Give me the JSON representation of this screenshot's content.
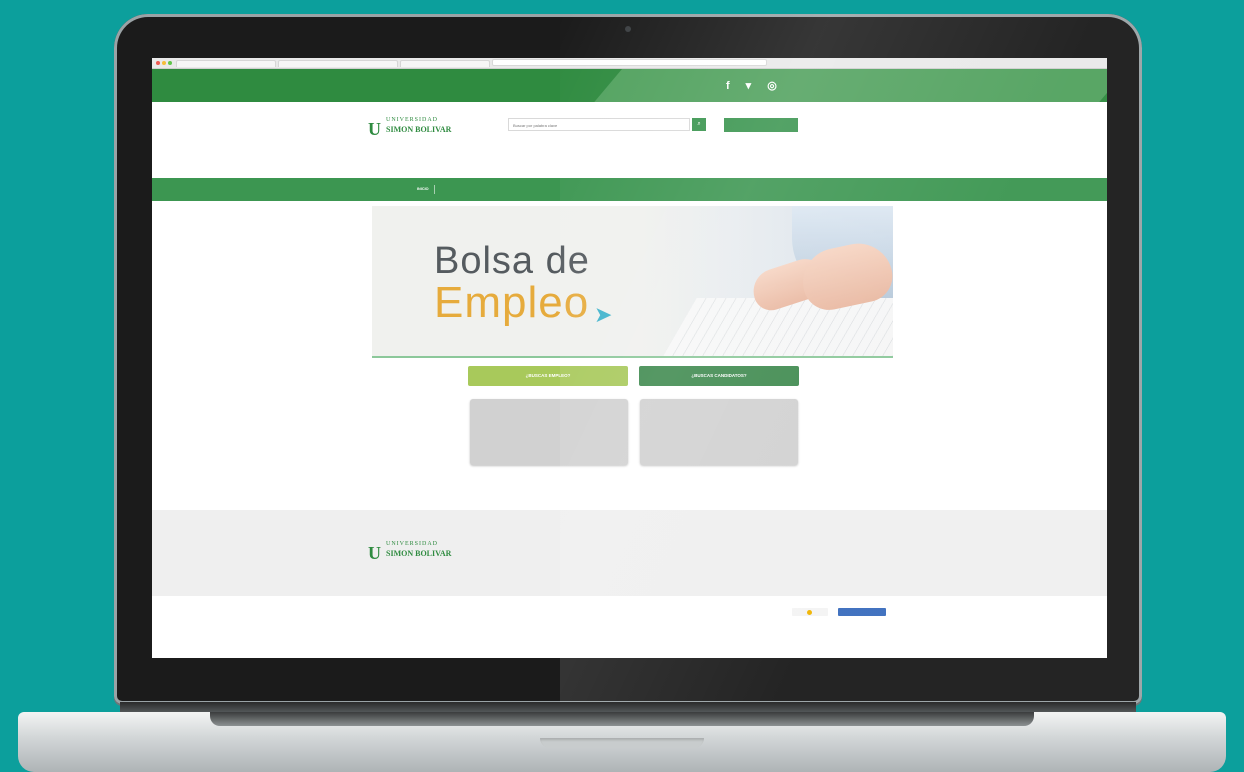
{
  "browser": {
    "tabs": [
      "",
      "",
      ""
    ],
    "url": ""
  },
  "social": {
    "facebook": "f",
    "twitter": "▾",
    "instagram": "◎"
  },
  "header": {
    "logo_line1": "UNIVERSIDAD",
    "logo_line2": "SIMON BOLIVAR",
    "search_placeholder": "Buscar por palabra clave",
    "search_button": "⌕",
    "header_button": ""
  },
  "nav": {
    "items": [
      "INICIO",
      "",
      "",
      "",
      "",
      ""
    ]
  },
  "banner": {
    "line1": "Bolsa de",
    "line2": "Empleo"
  },
  "cards": {
    "left_button": "¿BUSCAS EMPLEO?",
    "right_button": "¿BUSCAS CANDIDATOS?",
    "left_text": "",
    "right_text": ""
  },
  "footer": {
    "logo_line1": "UNIVERSIDAD",
    "logo_line2": "SIMON BOLIVAR",
    "text": "",
    "link": "",
    "powered": ""
  },
  "bottom": {
    "text": "",
    "badge1": "",
    "badge2": ""
  },
  "colors": {
    "page_bg": "#0c9f9c",
    "brand_green": "#2f8b40",
    "nav_green": "#3c9651",
    "light_green": "#a8c95b",
    "banner_orange": "#e6ab3c"
  }
}
